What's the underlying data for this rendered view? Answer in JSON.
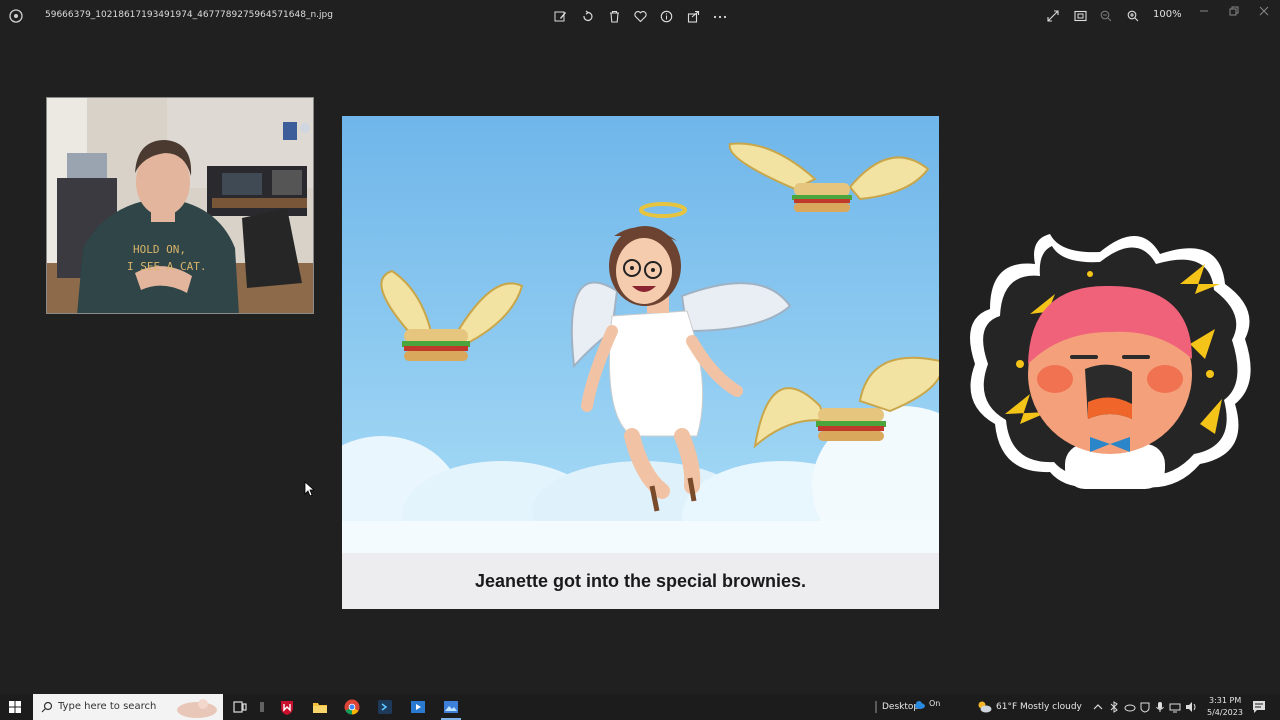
{
  "titlebar": {
    "filename": "59666379_10218617193491974_4677789275964571648_n.jpg",
    "zoom": "100%"
  },
  "slide": {
    "caption": "Jeanette got into the special brownies."
  },
  "webcam": {
    "shirt_text_line1": "HOLD ON,",
    "shirt_text_line2": "I SEE A CAT."
  },
  "taskbar": {
    "search_placeholder": "Type here to search",
    "desktop_label": "Desktop",
    "onedrive_status": "On",
    "weather_temp": "61°F",
    "weather_desc": "Mostly cloudy",
    "time": "3:31 PM",
    "date": "5/4/2023"
  },
  "colors": {
    "background": "#202020",
    "taskbar": "#1c1c1c",
    "sky": "#7ec3ef",
    "sticker_bolt": "#f5c418",
    "sticker_hair": "#f0627a"
  }
}
